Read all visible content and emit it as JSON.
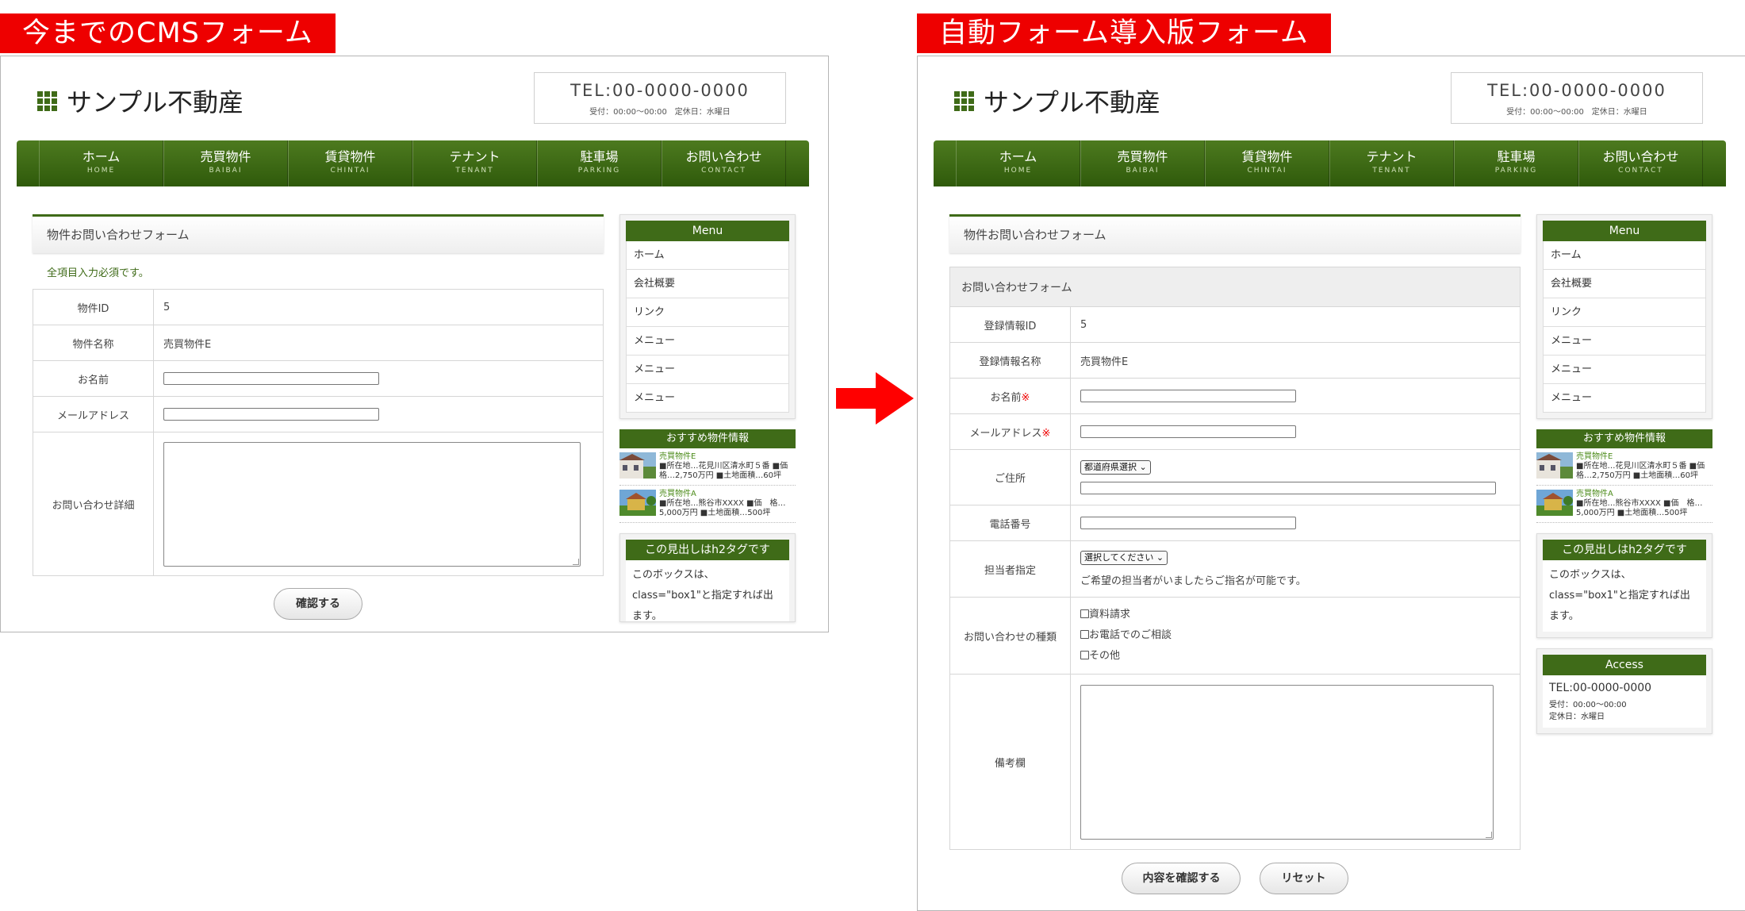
{
  "labels": {
    "left": "今までのCMSフォーム",
    "right": "自動フォーム導入版フォーム"
  },
  "site": {
    "name": "サンプル不動産",
    "tel": "TEL:00-0000-0000",
    "hours": "受付：00:00〜00:00　定休日：水曜日"
  },
  "nav": [
    {
      "jp": "ホーム",
      "en": "HOME"
    },
    {
      "jp": "売買物件",
      "en": "BAIBAI"
    },
    {
      "jp": "賃貸物件",
      "en": "CHINTAI"
    },
    {
      "jp": "テナント",
      "en": "TENANT"
    },
    {
      "jp": "駐車場",
      "en": "PARKING"
    },
    {
      "jp": "お問い合わせ",
      "en": "CONTACT"
    }
  ],
  "old_form": {
    "title": "物件お問い合わせフォーム",
    "required_note": "全項目入力必須です。",
    "rows": {
      "id_label": "物件ID",
      "id_value": "5",
      "name_label": "物件名称",
      "name_value": "売買物件E",
      "your_name": "お名前",
      "email": "メールアドレス",
      "detail": "お問い合わせ詳細"
    },
    "confirm_button": "確認する"
  },
  "new_form": {
    "title": "物件お問い合わせフォーム",
    "subtitle": "お問い合わせフォーム",
    "rows": {
      "id_label": "登録情報ID",
      "id_value": "5",
      "name_label": "登録情報名称",
      "name_value": "売買物件E",
      "your_name": "お名前",
      "email": "メールアドレス",
      "required_mark": "※",
      "address": "ご住所",
      "prefecture_select": "都道府県選択",
      "phone": "電話番号",
      "staff": "担当者指定",
      "staff_select": "選択してください",
      "staff_note": "ご希望の担当者がいましたらご指名が可能です。",
      "inquiry_type": "お問い合わせの種類",
      "remarks": "備考欄"
    },
    "checkboxes": [
      "資料請求",
      "お電話でのご相談",
      "その他"
    ],
    "confirm_button": "内容を確認する",
    "reset_button": "リセット"
  },
  "sidebar": {
    "menu_title": "Menu",
    "menu_items": [
      "ホーム",
      "会社概要",
      "リンク",
      "メニュー",
      "メニュー",
      "メニュー"
    ],
    "recommended_title": "おすすめ物件情報",
    "recommended": [
      {
        "name": "売買物件E",
        "detail": "■所在地…花見川区清水町５番 ■価格…2,750万円 ■土地面積…60坪"
      },
      {
        "name": "売買物件A",
        "detail": "■所在地…熊谷市XXXX ■価　格…5,000万円 ■土地面積…500坪"
      }
    ],
    "h2_title": "この見出しはh2タグです",
    "h2_text": "このボックスは、class=\"box1\"と指定すれば出ます。",
    "access_title": "Access",
    "access_tel": "TEL:00-0000-0000",
    "access_hours": "受付：00:00〜00:00",
    "access_holiday": "定休日：水曜日"
  },
  "colors": {
    "accent_green": "#3f6b18",
    "label_red": "#ee0000",
    "arrow_red": "#ff0000"
  }
}
